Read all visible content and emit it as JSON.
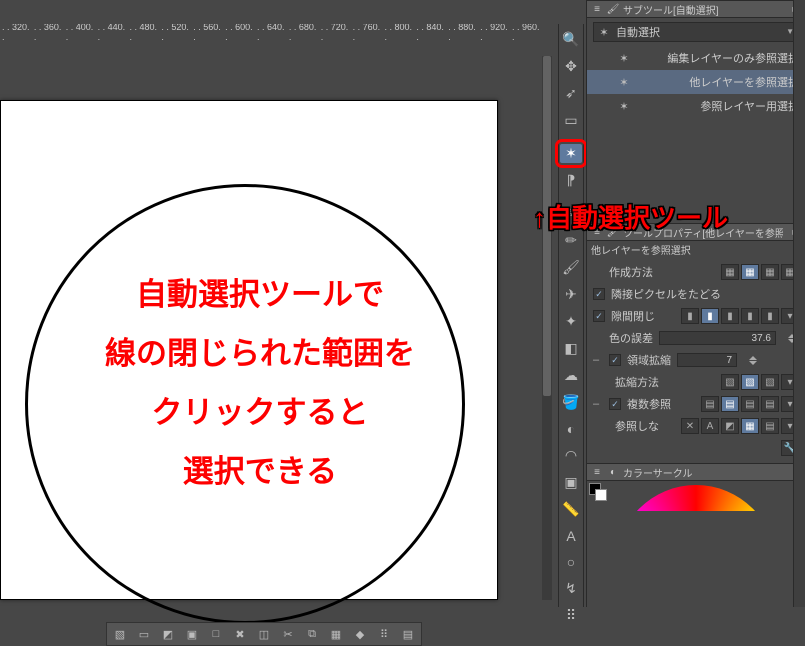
{
  "ruler_ticks": [
    "320",
    "360",
    "400",
    "440",
    "480",
    "520",
    "560",
    "600",
    "640",
    "680",
    "720",
    "760",
    "800",
    "840",
    "880",
    "920",
    "960"
  ],
  "annotation": {
    "line1": "自動選択ツールで",
    "line2": "線の閉じられた範囲を",
    "line3": "クリックすると",
    "line4": "選択できる"
  },
  "callout": "↑自動選択ツール",
  "toolbar": {
    "tools": [
      {
        "name": "magnifier-icon",
        "glyph": "🔍"
      },
      {
        "name": "move-icon",
        "glyph": "✥"
      },
      {
        "name": "operation-icon",
        "glyph": "➶"
      },
      {
        "name": "marquee-icon",
        "glyph": "▭"
      },
      {
        "name": "auto-select-icon",
        "glyph": "✶",
        "active": true,
        "highlight": true
      },
      {
        "name": "eyedropper-icon",
        "glyph": "⁋"
      },
      {
        "name": "pen-icon",
        "glyph": "✎"
      },
      {
        "name": "pencil-icon",
        "glyph": "✏"
      },
      {
        "name": "brush-icon",
        "glyph": "🖌"
      },
      {
        "name": "airbrush-icon",
        "glyph": "✈"
      },
      {
        "name": "decoration-icon",
        "glyph": "✦"
      },
      {
        "name": "eraser-icon",
        "glyph": "◧"
      },
      {
        "name": "blend-icon",
        "glyph": "☁"
      },
      {
        "name": "fill-icon",
        "glyph": "🪣"
      },
      {
        "name": "gradient-icon",
        "glyph": "◐"
      },
      {
        "name": "figure-icon",
        "glyph": "◠"
      },
      {
        "name": "frame-icon",
        "glyph": "▣"
      },
      {
        "name": "ruler-icon",
        "glyph": "📏"
      },
      {
        "name": "text-icon",
        "glyph": "A"
      },
      {
        "name": "balloon-icon",
        "glyph": "○"
      },
      {
        "name": "correct-icon",
        "glyph": "↯"
      },
      {
        "name": "dust-icon",
        "glyph": "⠿"
      }
    ]
  },
  "subtool": {
    "title": "サブツール[自動選択]",
    "selected_group": "自動選択",
    "items": [
      {
        "label": "編集レイヤーのみ参照選択"
      },
      {
        "label": "他レイヤーを参照選択",
        "selected": true
      },
      {
        "label": "参照レイヤー用選択"
      }
    ]
  },
  "toolprop": {
    "title": "ツールプロパティ[他レイヤーを参照選択]",
    "subtitle": "他レイヤーを参照選択",
    "rows": {
      "create_label": "作成方法",
      "adjacent_label": "隣接ピクセルをたどる",
      "close_gap_label": "隙間閉じ",
      "tolerance_label": "色の誤差",
      "tolerance_value": "37.6",
      "area_scale_label": "領域拡縮",
      "area_scale_value": "7",
      "scale_method_label": "拡縮方法",
      "multi_ref_label": "複数参照",
      "ref_off_label": "参照しな"
    }
  },
  "color_panel": {
    "title": "カラーサークル"
  }
}
